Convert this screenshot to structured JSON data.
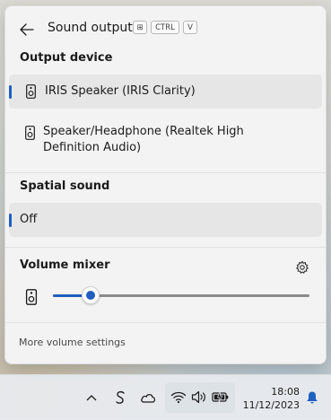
{
  "header": {
    "title": "Sound output",
    "shortcut": {
      "win_key": "⊞",
      "ctrl_key": "CTRL",
      "v_key": "V"
    }
  },
  "output_device": {
    "section_title": "Output device",
    "items": [
      {
        "label": "IRIS Speaker (IRIS Clarity)",
        "selected": true,
        "icon": "speaker-icon"
      },
      {
        "label": "Speaker/Headphone (Realtek High Definition Audio)",
        "selected": false,
        "icon": "speaker-icon"
      }
    ]
  },
  "spatial_sound": {
    "section_title": "Spatial sound",
    "items": [
      {
        "label": "Off",
        "selected": true
      }
    ]
  },
  "volume_mixer": {
    "section_title": "Volume mixer",
    "settings_icon": "gear-icon",
    "device_icon": "speaker-icon",
    "level": 0.12
  },
  "footer": {
    "link": "More volume settings"
  },
  "taskbar": {
    "icons": [
      "chevron-up-icon",
      "app-s-icon",
      "onedrive-cloud-icon",
      "wifi-icon",
      "volume-icon",
      "battery-charging-icon",
      "notification-bell-icon"
    ],
    "time": "18:08",
    "date": "11/12/2023"
  },
  "colors": {
    "accent": "#1f5fbf",
    "panel_bg": "#f3f3f3",
    "selected_bg": "#e6e6e6"
  }
}
